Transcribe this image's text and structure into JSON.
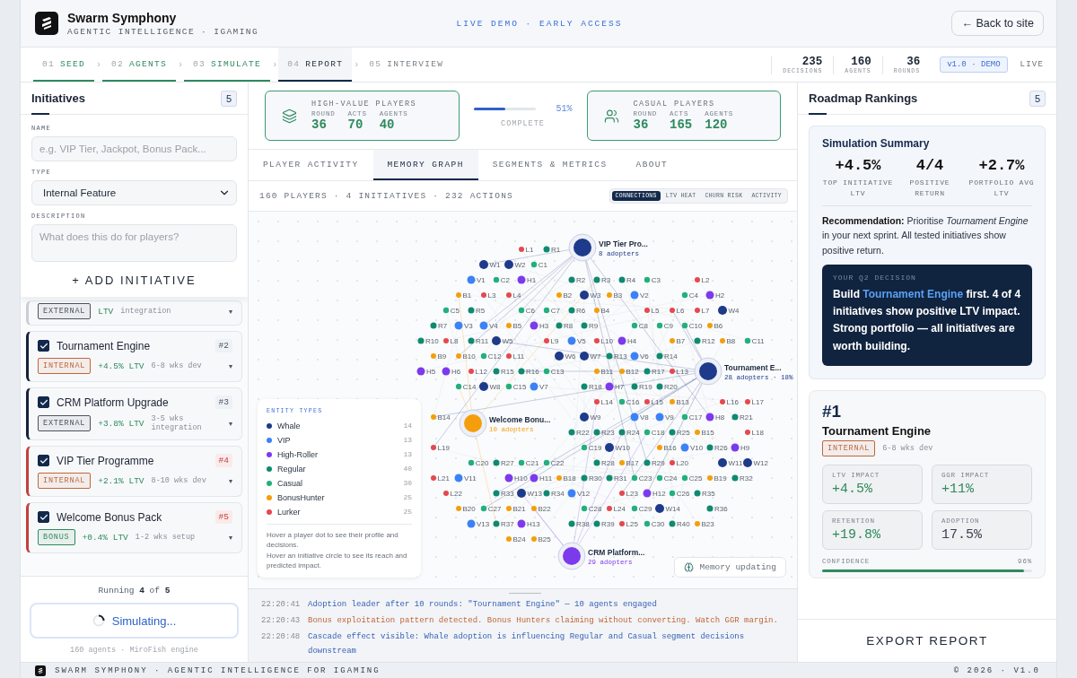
{
  "header": {
    "title": "Swarm Symphony",
    "subtitle": "AGENTIC INTELLIGENCE · IGAMING",
    "banner": "LIVE DEMO · EARLY ACCESS",
    "back_button": "← Back to site"
  },
  "steps": [
    {
      "number": "01",
      "label": "SEED",
      "done": true,
      "selected": false,
      "sep": "›"
    },
    {
      "number": "02",
      "label": "AGENTS",
      "done": true,
      "selected": false,
      "sep": "›"
    },
    {
      "number": "03",
      "label": "SIMULATE",
      "done": true,
      "selected": false,
      "sep": "›"
    },
    {
      "number": "04",
      "label": "REPORT",
      "done": false,
      "selected": true,
      "sep": "›"
    },
    {
      "number": "05",
      "label": "INTERVIEW",
      "done": false,
      "selected": false
    }
  ],
  "stats": [
    {
      "value": "235",
      "label": "DECISIONS"
    },
    {
      "value": "160",
      "label": "AGENTS"
    },
    {
      "value": "36",
      "label": "ROUNDS"
    }
  ],
  "version": "v1.0 · DEMO",
  "live": "LIVE",
  "initiatives_panel": {
    "title": "Initiatives",
    "count": "5",
    "form": {
      "name_label": "NAME",
      "name_placeholder": "e.g. VIP Tier, Jackpot, Bonus Pack...",
      "type_label": "TYPE",
      "type_value": "Internal Feature",
      "description_label": "DESCRIPTION",
      "description_placeholder": "What does this do for players?",
      "add_button": "+ ADD INITIATIVE"
    },
    "items": [
      {
        "partial": true,
        "tag": {
          "label": "EXTERNAL",
          "color": "#4a5462"
        },
        "ltv": "LTV",
        "effort": "integration",
        "caret": "▾"
      },
      {
        "partial": false,
        "checked": true,
        "flagged": false,
        "name": "Tournament Engine",
        "rank": "#2",
        "tag": {
          "label": "INTERNAL",
          "color": "#c2663a"
        },
        "ltv": "+4.5% LTV",
        "effort": "6-8 wks dev",
        "caret": "▾"
      },
      {
        "partial": false,
        "checked": true,
        "flagged": false,
        "name": "CRM Platform Upgrade",
        "rank": "#3",
        "tag": {
          "label": "EXTERNAL",
          "color": "#4a5462"
        },
        "ltv": "+3.8% LTV",
        "effort": "3-5 wks integration",
        "caret": "▾"
      },
      {
        "partial": false,
        "checked": true,
        "flagged": true,
        "name": "VIP Tier Programme",
        "rank": "#4",
        "tag": {
          "label": "INTERNAL",
          "color": "#c2663a"
        },
        "ltv": "+2.1% LTV",
        "effort": "8-10 wks dev",
        "caret": "▾"
      },
      {
        "partial": false,
        "checked": true,
        "flagged": true,
        "name": "Welcome Bonus Pack",
        "rank": "#5",
        "tag": {
          "label": "BONUS",
          "color": "#2f8a5e"
        },
        "ltv": "+0.4% LTV",
        "effort": "1-2 wks setup",
        "caret": "▾"
      }
    ],
    "running": "Running **4** of **5**",
    "simulate_button": "Simulating...",
    "engine_note": "160 agents · MiroFish engine"
  },
  "cohorts": [
    {
      "title": "HIGH-VALUE PLAYERS",
      "kind": "layers",
      "stats": [
        {
          "label": "ROUND",
          "value": "36"
        },
        {
          "label": "ACTS",
          "value": "70"
        },
        {
          "label": "AGENTS",
          "value": "40"
        }
      ]
    },
    {
      "title": "CASUAL PLAYERS",
      "kind": "users",
      "stats": [
        {
          "label": "ROUND",
          "value": "36"
        },
        {
          "label": "ACTS",
          "value": "165"
        },
        {
          "label": "AGENTS",
          "value": "120"
        }
      ]
    }
  ],
  "progress": {
    "level": 0.51,
    "reading": "51%",
    "label": "COMPLETE"
  },
  "tabs": [
    {
      "label": "PLAYER ACTIVITY",
      "selected": false
    },
    {
      "label": "MEMORY GRAPH",
      "selected": true
    },
    {
      "label": "SEGMENTS & METRICS",
      "selected": false
    },
    {
      "label": "ABOUT",
      "selected": false
    }
  ],
  "graph": {
    "summary": "160 PLAYERS · 4 INITIATIVES · 232 ACTIONS",
    "modes": [
      {
        "label": "CONNECTIONS",
        "selected": true
      },
      {
        "label": "LTV HEAT",
        "selected": false
      },
      {
        "label": "CHURN RISK",
        "selected": false
      },
      {
        "label": "ACTIVITY",
        "selected": false
      }
    ],
    "initiatives": [
      {
        "label": "VIP Tier Pro...",
        "note": "8 adopters",
        "color": "#1e3a8a"
      },
      {
        "label": "Tournament E...",
        "note": "28 adopters · 18%",
        "color": "#1e3a8a"
      },
      {
        "label": "Welcome Bonu...",
        "note": "10 adopters",
        "color": "#f59e0b"
      },
      {
        "label": "CRM Platform...",
        "note": "29 adopters",
        "color": "#7c3aed"
      }
    ],
    "legend_title": "ENTITY TYPES",
    "entity_types": [
      {
        "name": "Whale",
        "count": "14",
        "color": "#1e3a8a",
        "nodes": [
          "W1",
          "W2",
          "W3",
          "W4",
          "W5",
          "W6",
          "W7",
          "W8",
          "W9",
          "W10",
          "W11",
          "W12",
          "W13",
          "W14"
        ]
      },
      {
        "name": "VIP",
        "count": "13",
        "color": "#3b82f6",
        "nodes": [
          "V1",
          "V2",
          "V3",
          "V4",
          "V5",
          "V6",
          "V7",
          "V8",
          "V9",
          "V10",
          "V11",
          "V12",
          "V13"
        ]
      },
      {
        "name": "High-Roller",
        "count": "13",
        "color": "#7c3aed",
        "nodes": [
          "H1",
          "H2",
          "H3",
          "H4",
          "H5",
          "H6",
          "H7",
          "H8",
          "H9",
          "H10",
          "H11",
          "H12",
          "H13"
        ]
      },
      {
        "name": "Regular",
        "count": "40",
        "color": "#0f8a70",
        "nodes": [
          "R1",
          "R2",
          "R3",
          "R4",
          "R5",
          "R6",
          "R7",
          "R8",
          "R9",
          "R10",
          "R11",
          "R12",
          "R13",
          "R14",
          "R15",
          "R16",
          "R17",
          "R18",
          "R19",
          "R20",
          "R21",
          "R22",
          "R23",
          "R24",
          "R25",
          "R26",
          "R27",
          "R28",
          "R29",
          "R30",
          "R31",
          "R32",
          "R33",
          "R34",
          "R35",
          "R36",
          "R37",
          "R38",
          "R39",
          "R40"
        ]
      },
      {
        "name": "Casual",
        "count": "30",
        "color": "#22b07d",
        "nodes": [
          "C1",
          "C2",
          "C3",
          "C4",
          "C5",
          "C6",
          "C7",
          "C8",
          "C9",
          "C10",
          "C11",
          "C12",
          "C13",
          "C14",
          "C15",
          "C16",
          "C17",
          "C18",
          "C19",
          "C20",
          "C21",
          "C22",
          "C23",
          "C24",
          "C25",
          "C26",
          "C27",
          "C28",
          "C29",
          "C30"
        ]
      },
      {
        "name": "BonusHunter",
        "count": "25",
        "color": "#f59e0b",
        "nodes": [
          "B1",
          "B2",
          "B3",
          "B4",
          "B5",
          "B6",
          "B7",
          "B8",
          "B9",
          "B10",
          "B11",
          "B12",
          "B13",
          "B14",
          "B15",
          "B16",
          "B17",
          "B18",
          "B19",
          "B20",
          "B21",
          "B22",
          "B23",
          "B24",
          "B25"
        ]
      },
      {
        "name": "Lurker",
        "count": "25",
        "color": "#e5484d",
        "nodes": [
          "L1",
          "L2",
          "L3",
          "L4",
          "L5",
          "L6",
          "L7",
          "L8",
          "L9",
          "L10",
          "L11",
          "L12",
          "L13",
          "L14",
          "L15",
          "L16",
          "L17",
          "L18",
          "L19",
          "L20",
          "L21",
          "L22",
          "L23",
          "L24",
          "L25"
        ]
      }
    ],
    "hints": [
      "Hover a player dot to see their profile and decisions.",
      "Hover an initiative circle to see its reach and predicted impact."
    ],
    "memory_status": "Memory updating"
  },
  "log": [
    {
      "time": "22:20:41",
      "message": "Adoption leader after 10 rounds: \"Tournament Engine\" — 10 agents engaged",
      "warning": false
    },
    {
      "time": "22:20:43",
      "message": "Bonus exploitation pattern detected. Bonus Hunters claiming without converting. Watch GGR margin.",
      "warning": true
    },
    {
      "time": "22:20:48",
      "message": "Cascade effect visible: Whale adoption is influencing Regular and Casual segment decisions downstream",
      "warning": false
    }
  ],
  "rankings": {
    "title": "Roadmap Rankings",
    "count": "5",
    "summary": {
      "title": "Simulation Summary",
      "stats": [
        {
          "value": "+4.5%",
          "label": "TOP INITIATIVE LTV"
        },
        {
          "value": "4/4",
          "label": "POSITIVE RETURN"
        },
        {
          "value": "+2.7%",
          "label": "PORTFOLIO AVG LTV"
        }
      ],
      "recommendation": "**Recommendation:** Prioritise *Tournament Engine* in your next sprint. All tested initiatives show positive return.",
      "decision": {
        "label": "YOUR Q2 DECISION",
        "before": "Build ",
        "highlight": "Tournament Engine",
        "after": " first. 4 of 4 initiatives show positive LTV impact. Strong portfolio — all initiatives are worth building."
      }
    },
    "top": {
      "rank": "#1",
      "name": "Tournament Engine",
      "tag": {
        "label": "INTERNAL",
        "color": "#c2663a"
      },
      "effort": "6-8 wks dev",
      "metrics": [
        {
          "label": "LTV IMPACT",
          "value": "+4.5%",
          "positive": true
        },
        {
          "label": "GGR IMPACT",
          "value": "+11%",
          "positive": true
        },
        {
          "label": "RETENTION",
          "value": "+19.8%",
          "positive": true
        },
        {
          "label": "ADOPTION",
          "value": "17.5%",
          "positive": false
        }
      ],
      "confidence": {
        "label": "CONFIDENCE",
        "reading": "96%",
        "level": 0.96
      }
    },
    "export_button": "EXPORT REPORT"
  },
  "footer": {
    "left": "SWARM SYMPHONY · AGENTIC INTELLIGENCE FOR IGAMING",
    "right": "© 2026 · V1.0"
  }
}
